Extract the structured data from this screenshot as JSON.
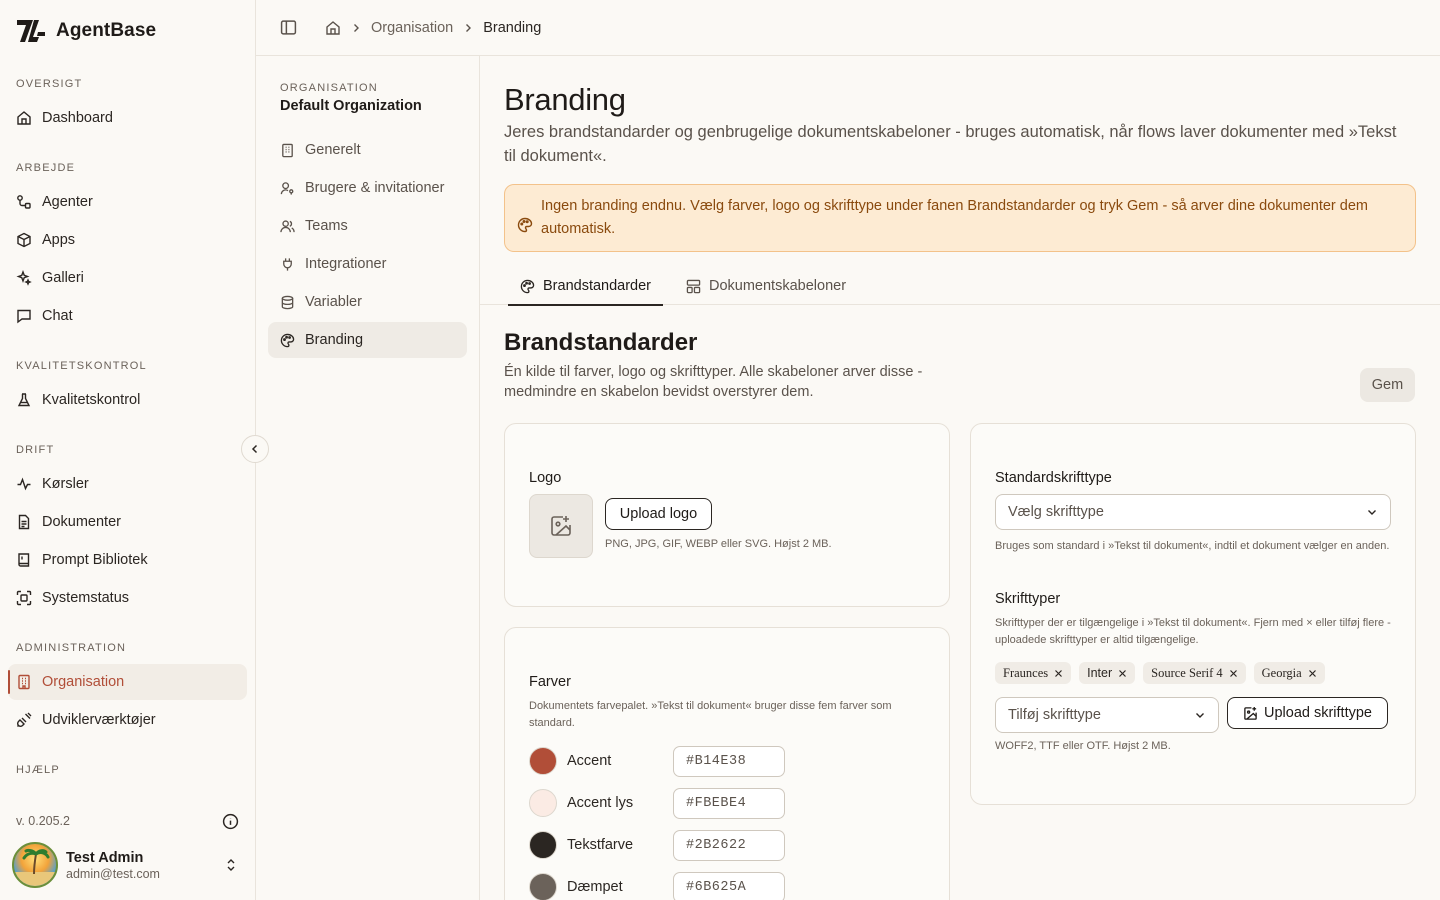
{
  "app": {
    "name": "AgentBase"
  },
  "sidebar": {
    "sections": [
      {
        "title": "OVERSIGT",
        "items": [
          {
            "label": "Dashboard",
            "icon": "home-icon"
          }
        ]
      },
      {
        "title": "ARBEJDE",
        "items": [
          {
            "label": "Agenter",
            "icon": "workflow-icon"
          },
          {
            "label": "Apps",
            "icon": "box-icon"
          },
          {
            "label": "Galleri",
            "icon": "sparkles-icon"
          },
          {
            "label": "Chat",
            "icon": "chat-icon"
          }
        ]
      },
      {
        "title": "KVALITETSKONTROL",
        "items": [
          {
            "label": "Kvalitetskontrol",
            "icon": "flask-icon"
          }
        ]
      },
      {
        "title": "DRIFT",
        "items": [
          {
            "label": "Kørsler",
            "icon": "activity-icon"
          },
          {
            "label": "Dokumenter",
            "icon": "document-icon"
          },
          {
            "label": "Prompt Bibliotek",
            "icon": "book-icon"
          },
          {
            "label": "Systemstatus",
            "icon": "status-icon"
          }
        ]
      },
      {
        "title": "ADMINISTRATION",
        "items": [
          {
            "label": "Organisation",
            "icon": "building-icon",
            "active": true
          },
          {
            "label": "Udviklerværktøjer",
            "icon": "plug-icon"
          }
        ]
      },
      {
        "title": "HJÆLP",
        "items": []
      }
    ],
    "version": "v. 0.205.2",
    "user": {
      "name": "Test Admin",
      "email": "admin@test.com"
    }
  },
  "breadcrumb": {
    "items": [
      "Organisation",
      "Branding"
    ]
  },
  "subnav": {
    "kicker": "ORGANISATION",
    "org_name": "Default Organization",
    "items": [
      {
        "label": "Generelt",
        "icon": "building-icon"
      },
      {
        "label": "Brugere & invitationer",
        "icon": "user-key-icon"
      },
      {
        "label": "Teams",
        "icon": "users-icon"
      },
      {
        "label": "Integrationer",
        "icon": "plug-icon"
      },
      {
        "label": "Variabler",
        "icon": "database-icon"
      },
      {
        "label": "Branding",
        "icon": "palette-icon",
        "active": true
      }
    ]
  },
  "page": {
    "title": "Branding",
    "description": "Jeres brandstandarder og genbrugelige dokumentskabeloner - bruges automatisk, når flows laver dokumenter med »Tekst til dokument«.",
    "alert": "Ingen branding endnu. Vælg farver, logo og skrifttype under fanen Brandstandarder og tryk Gem - så arver dine dokumenter dem automatisk."
  },
  "tabs": [
    {
      "label": "Brandstandarder",
      "icon": "palette-icon",
      "active": true
    },
    {
      "label": "Dokumentskabeloner",
      "icon": "template-icon"
    }
  ],
  "section": {
    "title": "Brandstandarder",
    "description": "Én kilde til farver, logo og skrifttyper. Alle skabeloner arver disse - medmindre en skabelon bevidst overstyrer dem.",
    "save_label": "Gem"
  },
  "logo_card": {
    "label": "Logo",
    "upload_label": "Upload logo",
    "hint": "PNG, JPG, GIF, WEBP eller SVG. Højst 2 MB."
  },
  "colors_card": {
    "label": "Farver",
    "hint": "Dokumentets farvepalet. »Tekst til dokument« bruger disse fem farver som standard.",
    "colors": [
      {
        "name": "Accent",
        "hex": "#B14E38"
      },
      {
        "name": "Accent lys",
        "hex": "#FBEBE4"
      },
      {
        "name": "Tekstfarve",
        "hex": "#2B2622"
      },
      {
        "name": "Dæmpet",
        "hex": "#6B625A"
      }
    ]
  },
  "font_card": {
    "default_label": "Standardskrifttype",
    "default_placeholder": "Vælg skrifttype",
    "default_hint": "Bruges som standard i »Tekst til dokument«, indtil et dokument vælger en anden.",
    "fonts_label": "Skrifttyper",
    "fonts_hint": "Skrifttyper der er tilgængelige i »Tekst til dokument«. Fjern med × eller tilføj flere - uploadede skrifttyper er altid tilgængelige.",
    "fonts": [
      "Fraunces",
      "Inter",
      "Source Serif 4",
      "Georgia"
    ],
    "add_placeholder": "Tilføj skrifttype",
    "upload_label": "Upload skrifttype",
    "upload_hint": "WOFF2, TTF eller OTF. Højst 2 MB."
  },
  "colors": {
    "accent": "#b14e38",
    "alert_bg": "#fdebd3",
    "alert_text": "#8a4a0e"
  }
}
